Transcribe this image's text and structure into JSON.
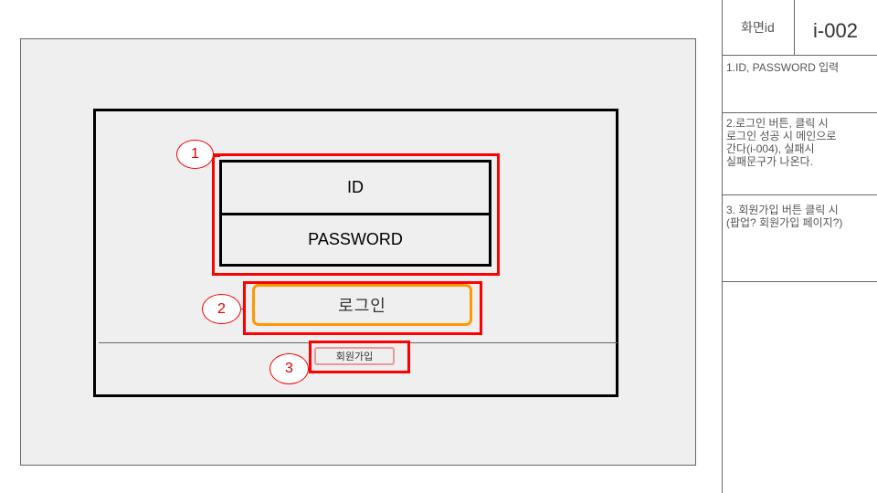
{
  "wireframe": {
    "id_field": "ID",
    "password_field": "PASSWORD",
    "login_button": "로그인",
    "signup_button": "회원가입",
    "callouts": [
      "1",
      "2",
      "3"
    ]
  },
  "spec_panel": {
    "screen_id_label": "화면id",
    "screen_id_value": "i-002",
    "notes": [
      "1.ID, PASSWORD 입력",
      "2.로그인 버튼, 클릭 시\n로그인 성공 시 메인으로\n간다(i-004), 실패시\n실패문구가 나온다.",
      "3. 회원가입 버튼 클릭 시\n(팝업? 회원가입 페이지?)"
    ]
  },
  "colors": {
    "highlight": "#ff0000",
    "login_border": "#ff9900",
    "signup_border": "#e59a9a",
    "canvas_bg": "#efefef"
  }
}
